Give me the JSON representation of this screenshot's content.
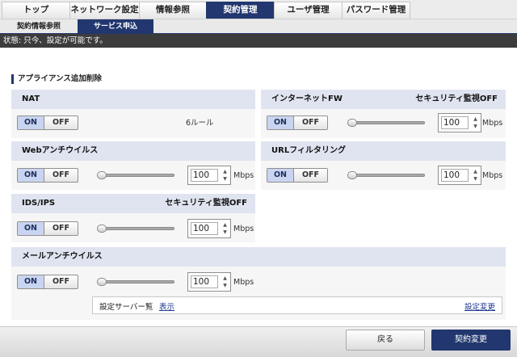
{
  "nav": {
    "tabs": [
      {
        "label": "トップ"
      },
      {
        "label": "ネットワーク設定"
      },
      {
        "label": "情報参照"
      },
      {
        "label": "契約管理"
      },
      {
        "label": "ユーザ管理"
      },
      {
        "label": "パスワード管理"
      }
    ],
    "active": "契約管理"
  },
  "subnav": {
    "tabs": [
      {
        "label": "契約情報参照"
      },
      {
        "label": "サービス申込"
      }
    ],
    "active": "サービス申込"
  },
  "status": {
    "text": "状態: 只今、設定が可能です。"
  },
  "section": {
    "title": "アプライアンス追加削除"
  },
  "toggle_labels": {
    "on": "ON",
    "off": "OFF"
  },
  "unit": "Mbps",
  "services": {
    "nat": {
      "title": "NAT",
      "state": "ON",
      "detail": "6ルール"
    },
    "internet_fw": {
      "title": "インターネットFW",
      "monitoring": "セキュリティ監視OFF",
      "state": "ON",
      "bandwidth": "100"
    },
    "web_antivirus": {
      "title": "Webアンチウイルス",
      "state": "ON",
      "bandwidth": "100"
    },
    "url_filtering": {
      "title": "URLフィルタリング",
      "state": "ON",
      "bandwidth": "100"
    },
    "ids_ips": {
      "title": "IDS/IPS",
      "monitoring": "セキュリティ監視OFF",
      "state": "ON",
      "bandwidth": "100"
    },
    "mail_antivirus": {
      "title": "メールアンチウイルス",
      "state": "ON",
      "bandwidth": "100"
    }
  },
  "server_list": {
    "label": "設定サーバー覧",
    "show_link": "表示",
    "change_link": "設定変更"
  },
  "footer": {
    "back": "戻る",
    "submit": "契約変更"
  },
  "colors": {
    "accent": "#22376f",
    "panel_header": "#dfe4f0",
    "status_bar": "#3c3c3c"
  },
  "icons": {
    "spinner": "spin-up-down-icon",
    "slider": "slider-thumb"
  }
}
